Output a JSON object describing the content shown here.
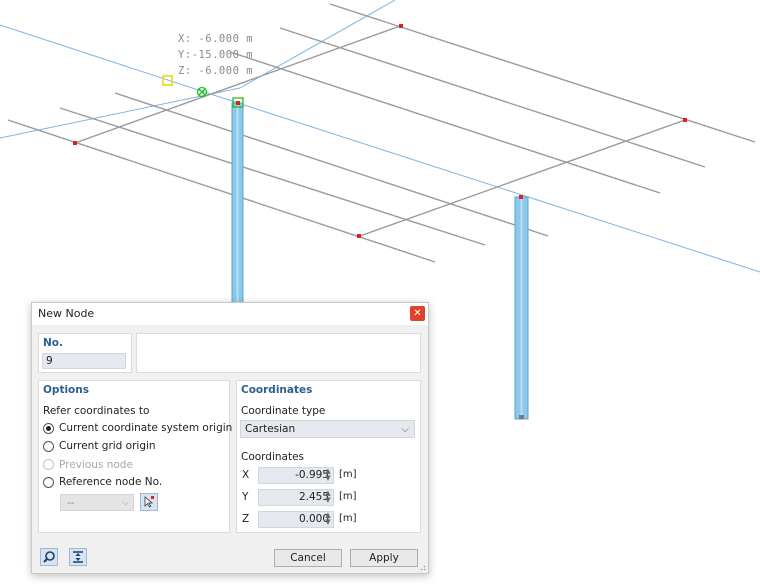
{
  "viewport": {
    "readout": {
      "x": "X: -6.000 m",
      "y": "Y:-15.000 m",
      "z": "Z: -6.000 m"
    },
    "colors": {
      "beam": "#9a9a9a",
      "grid_line": "#7fb4e6",
      "column": "#8cc8ea",
      "node": "#e0201c",
      "snap_marker": "#21c021",
      "cursor_box": "#e8d800"
    }
  },
  "dialog": {
    "title": "New Node",
    "close_icon": "close-icon",
    "number": {
      "header": "No.",
      "value": "9",
      "comment_value": ""
    },
    "options": {
      "header": "Options",
      "refer_label": "Refer coordinates to",
      "choices": [
        {
          "label": "Current coordinate system origin",
          "checked": true,
          "enabled": true
        },
        {
          "label": "Current grid origin",
          "checked": false,
          "enabled": true
        },
        {
          "label": "Previous node",
          "checked": false,
          "enabled": false
        },
        {
          "label": "Reference node No.",
          "checked": false,
          "enabled": true
        }
      ],
      "reference_select_value": "--"
    },
    "coordinates": {
      "header": "Coordinates",
      "type_label": "Coordinate type",
      "type_value": "Cartesian",
      "values_label": "Coordinates",
      "rows": [
        {
          "axis": "X",
          "value": "-0.995",
          "unit": "[m]"
        },
        {
          "axis": "Y",
          "value": "2.455",
          "unit": "[m]"
        },
        {
          "axis": "Z",
          "value": "0.000",
          "unit": "[m]"
        }
      ]
    },
    "buttons": {
      "cancel": "Cancel",
      "apply": "Apply"
    }
  }
}
